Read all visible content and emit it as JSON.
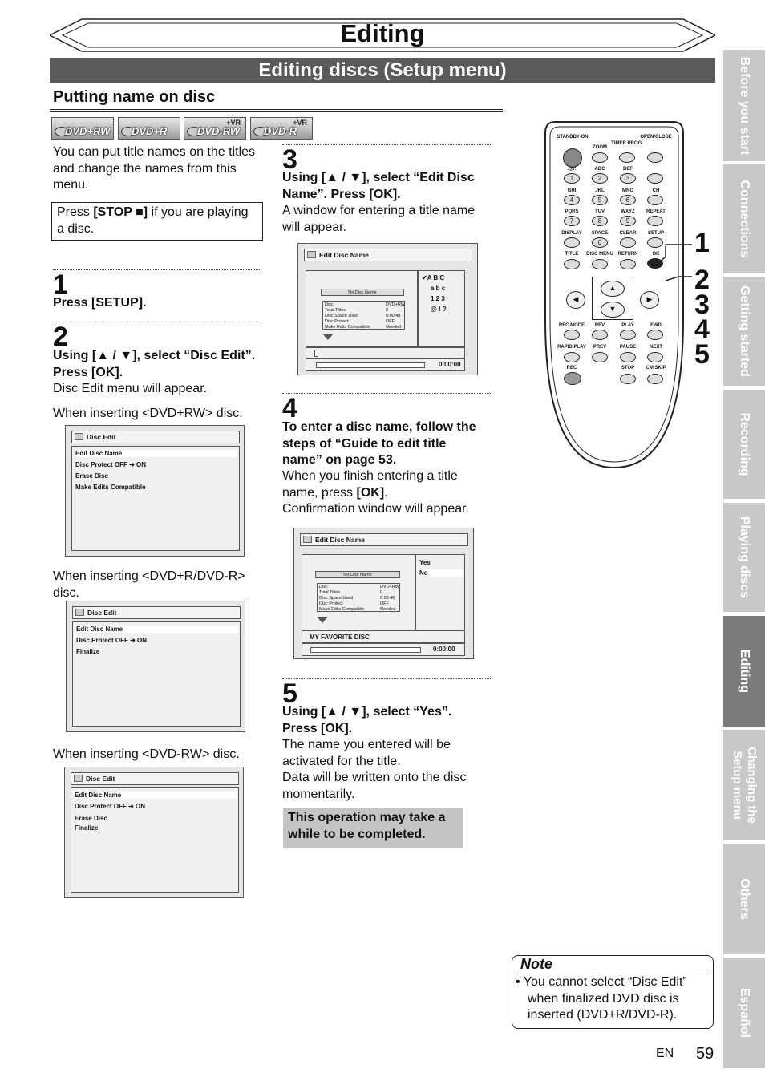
{
  "header": {
    "title": "Editing",
    "subtitle": "Editing discs (Setup menu)"
  },
  "section": {
    "title": "Putting name on disc"
  },
  "disc_types": [
    {
      "label": "DVD+RW",
      "vr": ""
    },
    {
      "label": "DVD+R",
      "vr": ""
    },
    {
      "label": "DVD-RW",
      "vr": "+VR"
    },
    {
      "label": "DVD-R",
      "vr": "+VR"
    }
  ],
  "intro": "You can put title names on the titles and change the names from this menu.",
  "stop_note": {
    "prefix": "Press ",
    "key": "[STOP ■]",
    "suffix": " if you are playing a disc."
  },
  "step1": {
    "num": "1",
    "heading": "Press [SETUP]."
  },
  "step2": {
    "num": "2",
    "heading": "Using [▲ / ▼], select “Disc Edit”. Press [OK].",
    "body": "Disc Edit menu will appear.",
    "case_rw_plus": "When inserting <DVD+RW> disc.",
    "case_r": "When inserting <DVD+R/DVD-R> disc.",
    "case_rw_minus": "When inserting <DVD-RW> disc."
  },
  "menu_screens": {
    "title": "Disc Edit",
    "plus_rw": [
      "Edit Disc Name",
      "Disc Protect OFF  ➜  ON",
      "Erase Disc",
      "Make Edits Compatible"
    ],
    "plus_r": [
      "Edit Disc Name",
      "Disc Protect OFF  ➜  ON",
      "Finalize"
    ],
    "minus_rw": [
      "Edit Disc Name",
      "Disc Protect OFF  ➜  ON",
      "Erase Disc",
      "Finalize"
    ]
  },
  "step3": {
    "num": "3",
    "heading": "Using [▲ / ▼], select “Edit Disc Name”. Press [OK].",
    "body": "A window for entering a title name will appear.",
    "screen": {
      "title": "Edit Disc Name",
      "name_field": "No Disc Name",
      "info_labels": [
        "Disc",
        "Total Titles",
        "Disc Space Used",
        "Disc Protect",
        "Make Edits Compatible"
      ],
      "info_values": [
        "DVD+RW",
        "0",
        "0:00:48",
        "OFF",
        "Needed"
      ],
      "chars": [
        "✔A  B  C",
        "a  b  c",
        "1  2  3",
        "@  !  ?"
      ],
      "time": "0:00:00"
    }
  },
  "step4": {
    "num": "4",
    "heading": "To enter a disc name, follow the steps of “Guide to edit title name” on page 53.",
    "body1_prefix": "When you finish entering a title name, press ",
    "body1_key": "[OK]",
    "body1_suffix": ".",
    "body2": "Confirmation window will appear.",
    "screen": {
      "title": "Edit Disc Name",
      "name_field": "No Disc Name",
      "info_labels": [
        "Disc",
        "Total Titles",
        "Disc Space Used",
        "Disc Protect",
        "Make Edits Compatible"
      ],
      "info_values": [
        "DVD+RW",
        "0",
        "0:00:48",
        "OFF",
        "Needed"
      ],
      "options": [
        "Yes",
        "No"
      ],
      "entered": "MY FAVORITE DISC",
      "time": "0:00:00"
    }
  },
  "step5": {
    "num": "5",
    "heading": "Using [▲ / ▼], select “Yes”. Press [OK].",
    "body1": "The name you entered will be activated for the title.",
    "body2": "Data will be written onto the disc momentarily.",
    "callout": "This operation may take a while to be completed."
  },
  "remote": {
    "labels": {
      "standby": "STANDBY-ON",
      "open": "OPEN/CLOSE",
      "zoom": "ZOOM",
      "timer": "TIMER PROG.",
      "sym": ".@/:",
      "abc": "ABC",
      "def": "DEF",
      "ch": "CH",
      "ghi": "GHI",
      "jkl": "JKL",
      "mno": "MNO",
      "pqrs": "PQRS",
      "tuv": "TUV",
      "wxyz": "WXYZ",
      "repeat": "REPEAT",
      "display": "DISPLAY",
      "space": "SPACE",
      "clear": "CLEAR",
      "setup": "SETUP",
      "title": "TITLE",
      "disc_menu": "DISC MENU",
      "return": "RETURN",
      "ok": "OK",
      "rec_mode": "REC MODE",
      "rev": "REV",
      "play": "PLAY",
      "fwd": "FWD",
      "rapid": "RAPID PLAY",
      "prev": "PREV",
      "pause": "PAUSE",
      "next": "NEXT",
      "rec": "REC",
      "stop": "STOP",
      "cm_skip": "CM SKIP"
    },
    "digits": [
      "1",
      "2",
      "3",
      "4",
      "5",
      "6",
      "7",
      "8",
      "9",
      "0"
    ],
    "callouts": [
      "1",
      "2",
      "3",
      "4",
      "5"
    ]
  },
  "note": {
    "title": "Note",
    "text": "• You cannot select “Disc Edit” when finalized DVD disc is inserted (DVD+R/DVD-R)."
  },
  "tabs": [
    "Before you start",
    "Connections",
    "Getting started",
    "Recording",
    "Playing discs",
    "Editing",
    "Changing the Setup menu",
    "Others",
    "Español"
  ],
  "footer": {
    "lang": "EN",
    "page": "59"
  }
}
